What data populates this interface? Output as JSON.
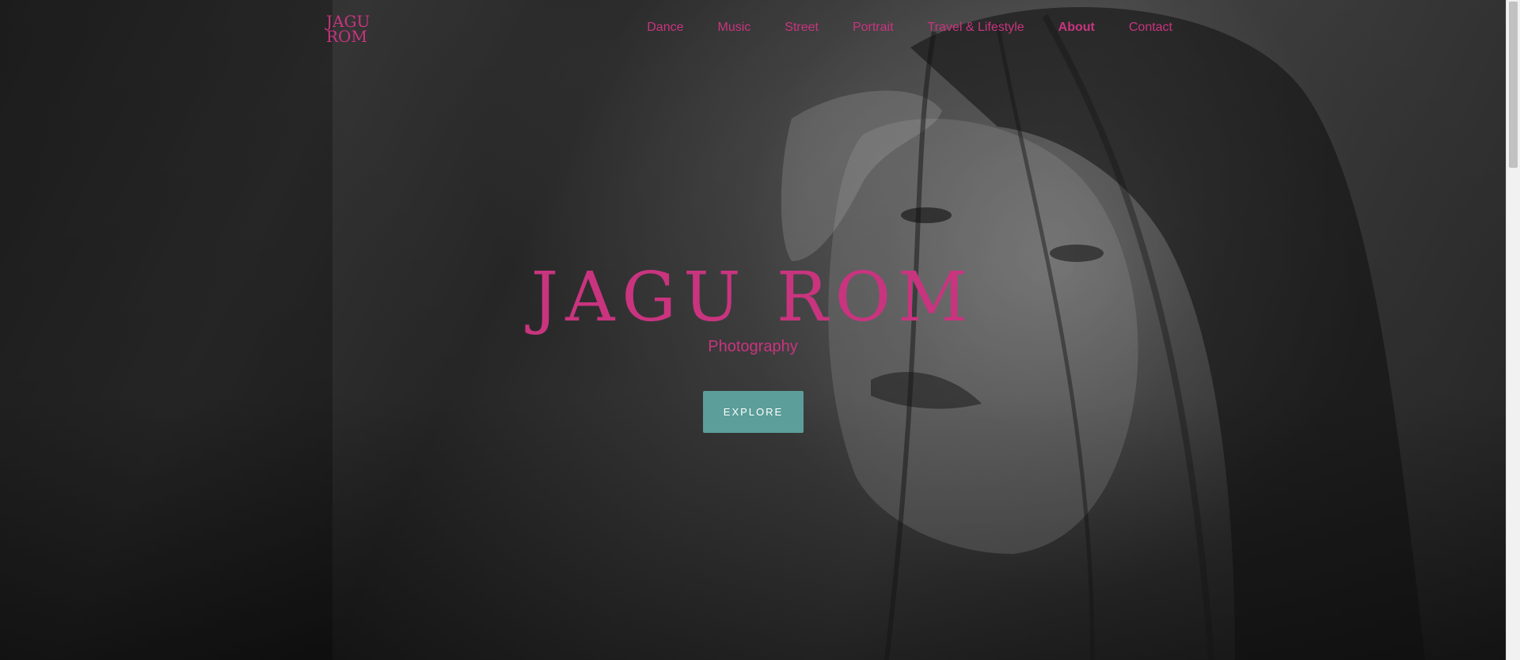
{
  "header": {
    "logo_line1": "JAGU",
    "logo_line2": "ROM",
    "nav": [
      {
        "label": "Dance"
      },
      {
        "label": "Music"
      },
      {
        "label": "Street"
      },
      {
        "label": "Portrait"
      },
      {
        "label": "Travel & Lifestyle"
      },
      {
        "label": "About"
      },
      {
        "label": "Contact"
      }
    ]
  },
  "hero": {
    "title": "JAGU ROM",
    "subtitle": "Photography",
    "cta_label": "EXPLORE"
  },
  "colors": {
    "accent": "#c9347f",
    "button": "#5b9e9a",
    "background": "#2e2e2e"
  }
}
